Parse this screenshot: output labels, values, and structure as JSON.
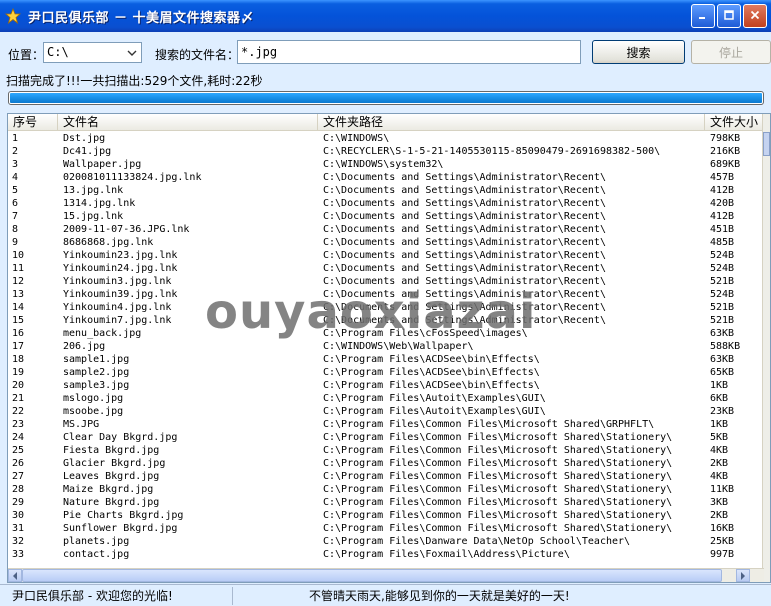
{
  "window": {
    "title": "尹口民俱乐部 － 十美眉文件搜索器〆"
  },
  "search": {
    "location_label": "位置：",
    "location_value": "C:\\",
    "filename_label": "搜索的文件名：",
    "filename_value": "*.jpg",
    "search_button": "搜索",
    "stop_button": "停止"
  },
  "status_line": "扫描完成了!!!一共扫描出:529个文件,耗时:22秒",
  "progress": {
    "percent": 100,
    "color": "#1890e8"
  },
  "table": {
    "headers": [
      "序号",
      "文件名",
      "文件夹路径",
      "文件大小"
    ],
    "rows": [
      [
        "1",
        "Dst.jpg",
        "C:\\WINDOWS\\",
        "798KB"
      ],
      [
        "2",
        "Dc41.jpg",
        "C:\\RECYCLER\\S-1-5-21-1405530115-85090479-2691698382-500\\",
        "216KB"
      ],
      [
        "3",
        "Wallpaper.jpg",
        "C:\\WINDOWS\\system32\\",
        "689KB"
      ],
      [
        "4",
        "020081011133824.jpg.lnk",
        "C:\\Documents and Settings\\Administrator\\Recent\\",
        "457B"
      ],
      [
        "5",
        "13.jpg.lnk",
        "C:\\Documents and Settings\\Administrator\\Recent\\",
        "412B"
      ],
      [
        "6",
        "1314.jpg.lnk",
        "C:\\Documents and Settings\\Administrator\\Recent\\",
        "420B"
      ],
      [
        "7",
        "15.jpg.lnk",
        "C:\\Documents and Settings\\Administrator\\Recent\\",
        "412B"
      ],
      [
        "8",
        "2009-11-07-36.JPG.lnk",
        "C:\\Documents and Settings\\Administrator\\Recent\\",
        "451B"
      ],
      [
        "9",
        "8686868.jpg.lnk",
        "C:\\Documents and Settings\\Administrator\\Recent\\",
        "485B"
      ],
      [
        "10",
        "Yinkoumin23.jpg.lnk",
        "C:\\Documents and Settings\\Administrator\\Recent\\",
        "524B"
      ],
      [
        "11",
        "Yinkoumin24.jpg.lnk",
        "C:\\Documents and Settings\\Administrator\\Recent\\",
        "524B"
      ],
      [
        "12",
        "Yinkoumin3.jpg.lnk",
        "C:\\Documents and Settings\\Administrator\\Recent\\",
        "521B"
      ],
      [
        "13",
        "Yinkoumin39.jpg.lnk",
        "C:\\Documents and Settings\\Administrator\\Recent\\",
        "524B"
      ],
      [
        "14",
        "Yinkoumin4.jpg.lnk",
        "C:\\Documents and Settings\\Administrator\\Recent\\",
        "521B"
      ],
      [
        "15",
        "Yinkoumin7.jpg.lnk",
        "C:\\Documents and Settings\\Administrator\\Recent\\",
        "521B"
      ],
      [
        "16",
        "menu_back.jpg",
        "C:\\Program Files\\cFosSpeed\\images\\",
        "63KB"
      ],
      [
        "17",
        "206.jpg",
        "C:\\WINDOWS\\Web\\Wallpaper\\",
        "588KB"
      ],
      [
        "18",
        "sample1.jpg",
        "C:\\Program Files\\ACDSee\\bin\\Effects\\",
        "63KB"
      ],
      [
        "19",
        "sample2.jpg",
        "C:\\Program Files\\ACDSee\\bin\\Effects\\",
        "65KB"
      ],
      [
        "20",
        "sample3.jpg",
        "C:\\Program Files\\ACDSee\\bin\\Effects\\",
        "1KB"
      ],
      [
        "21",
        "mslogo.jpg",
        "C:\\Program Files\\Autoit\\Examples\\GUI\\",
        "6KB"
      ],
      [
        "22",
        "msoobe.jpg",
        "C:\\Program Files\\Autoit\\Examples\\GUI\\",
        "23KB"
      ],
      [
        "23",
        "MS.JPG",
        "C:\\Program Files\\Common Files\\Microsoft Shared\\GRPHFLT\\",
        "1KB"
      ],
      [
        "24",
        "Clear Day Bkgrd.jpg",
        "C:\\Program Files\\Common Files\\Microsoft Shared\\Stationery\\",
        "5KB"
      ],
      [
        "25",
        "Fiesta Bkgrd.jpg",
        "C:\\Program Files\\Common Files\\Microsoft Shared\\Stationery\\",
        "4KB"
      ],
      [
        "26",
        "Glacier Bkgrd.jpg",
        "C:\\Program Files\\Common Files\\Microsoft Shared\\Stationery\\",
        "2KB"
      ],
      [
        "27",
        "Leaves Bkgrd.jpg",
        "C:\\Program Files\\Common Files\\Microsoft Shared\\Stationery\\",
        "4KB"
      ],
      [
        "28",
        "Maize Bkgrd.jpg",
        "C:\\Program Files\\Common Files\\Microsoft Shared\\Stationery\\",
        "11KB"
      ],
      [
        "29",
        "Nature Bkgrd.jpg",
        "C:\\Program Files\\Common Files\\Microsoft Shared\\Stationery\\",
        "3KB"
      ],
      [
        "30",
        "Pie Charts Bkgrd.jpg",
        "C:\\Program Files\\Common Files\\Microsoft Shared\\Stationery\\",
        "2KB"
      ],
      [
        "31",
        "Sunflower Bkgrd.jpg",
        "C:\\Program Files\\Common Files\\Microsoft Shared\\Stationery\\",
        "16KB"
      ],
      [
        "32",
        "planets.jpg",
        "C:\\Program Files\\Danware Data\\NetOp School\\Teacher\\",
        "25KB"
      ],
      [
        "33",
        "contact.jpg",
        "C:\\Program Files\\Foxmail\\Address\\Picture\\",
        "997B"
      ]
    ]
  },
  "watermark": "ouyaoxiazai",
  "statusbar": {
    "left": "尹口民俱乐部 - 欢迎您的光临!",
    "right": "不管晴天雨天,能够见到你的一天就是美好的一天!"
  },
  "icons": {
    "app": "star-icon",
    "minimize": "minimize-icon",
    "maximize": "maximize-icon",
    "close": "close-icon",
    "dropdown": "chevron-down-icon"
  }
}
